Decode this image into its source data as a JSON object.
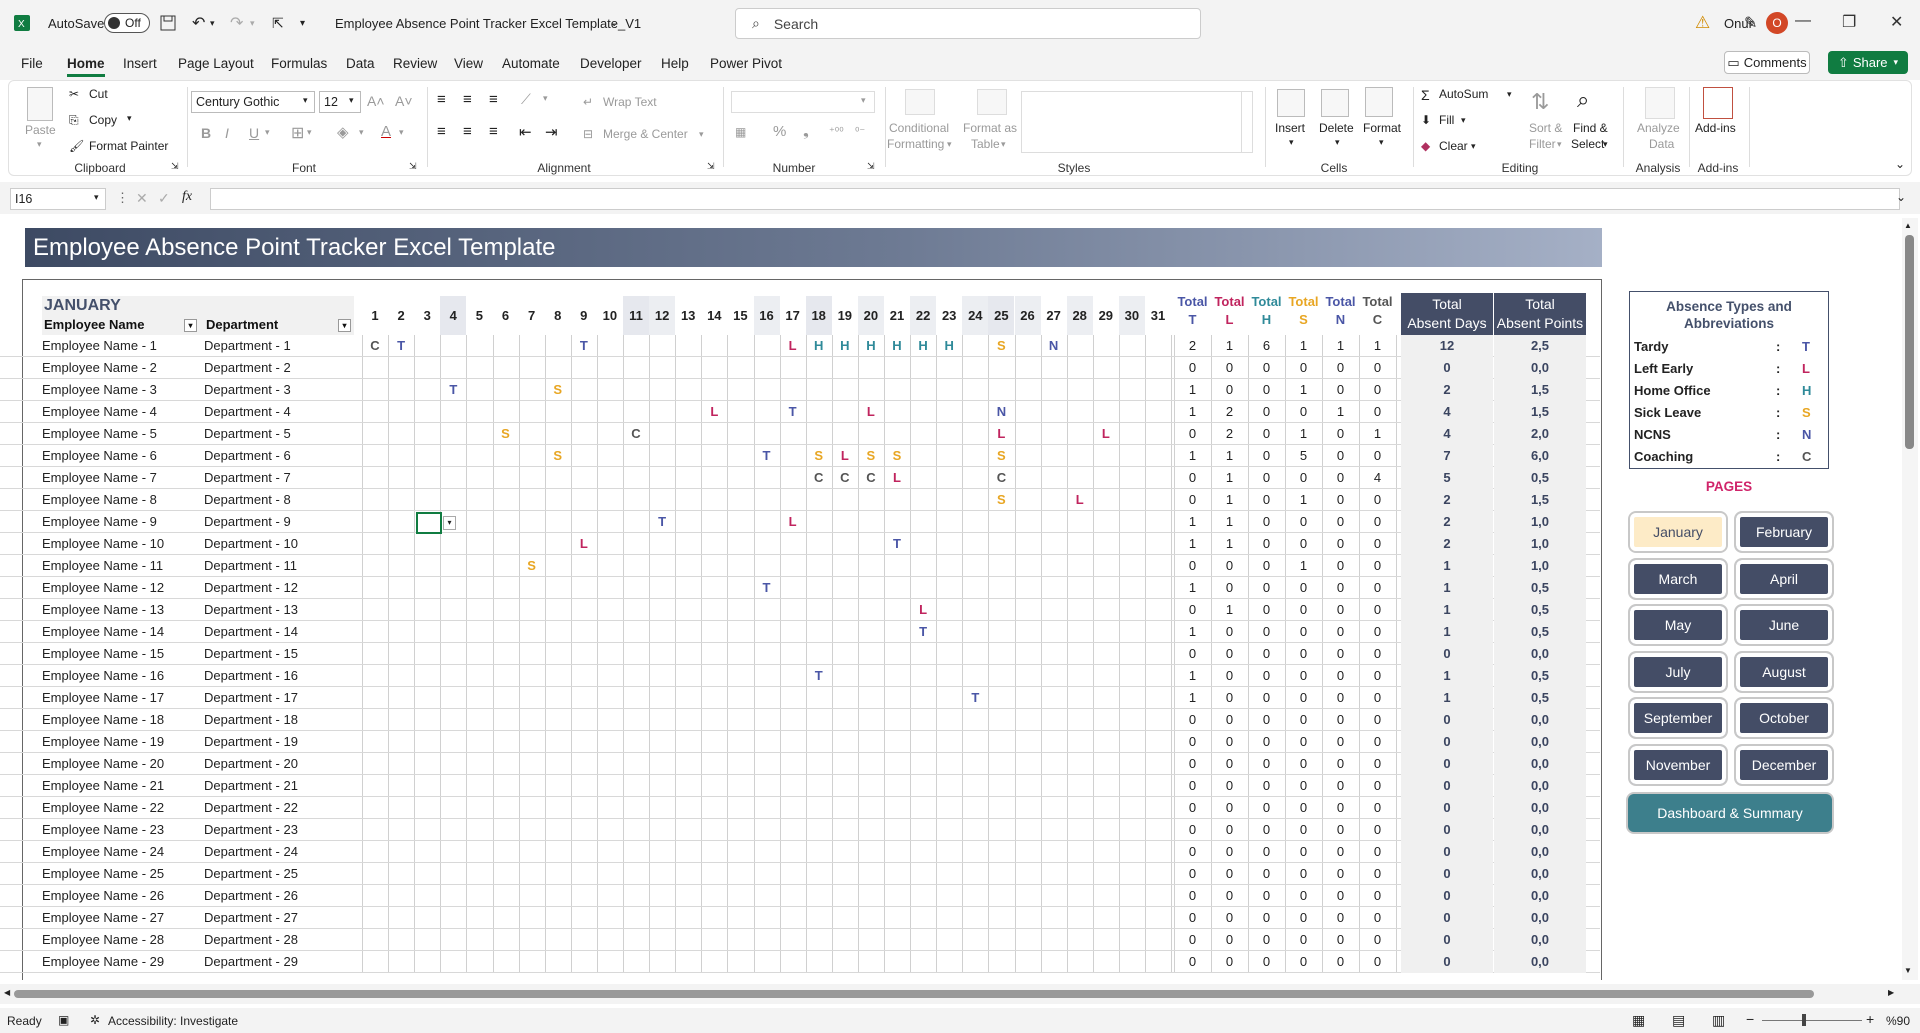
{
  "titlebar": {
    "autosave_label": "AutoSave",
    "autosave_state": "Off",
    "file_title": "Employee Absence Point Tracker Excel Template_V1",
    "search_placeholder": "Search",
    "user_name": "Onur",
    "user_initial": "O"
  },
  "menu": {
    "items": [
      "File",
      "Home",
      "Insert",
      "Page Layout",
      "Formulas",
      "Data",
      "Review",
      "View",
      "Automate",
      "Developer",
      "Help",
      "Power Pivot"
    ],
    "active": "Home",
    "comments_label": "Comments",
    "share_label": "Share"
  },
  "ribbon": {
    "paste": "Paste",
    "cut": "Cut",
    "copy": "Copy",
    "format_painter": "Format Painter",
    "group_clipboard": "Clipboard",
    "font_name": "Century Gothic",
    "font_size": "12",
    "group_font": "Font",
    "wrap_text": "Wrap Text",
    "merge_center": "Merge & Center",
    "group_alignment": "Alignment",
    "group_number": "Number",
    "conditional_formatting": "Conditional",
    "conditional_formatting2": "Formatting",
    "format_as_table": "Format as",
    "format_as_table2": "Table",
    "group_styles": "Styles",
    "insert": "Insert",
    "delete": "Delete",
    "format": "Format",
    "group_cells": "Cells",
    "autosum": "AutoSum",
    "fill": "Fill",
    "clear": "Clear",
    "sort_filter": "Sort &",
    "sort_filter2": "Filter",
    "find_select": "Find &",
    "find_select2": "Select",
    "group_editing": "Editing",
    "analyze_data": "Analyze",
    "analyze_data2": "Data",
    "group_analysis": "Analysis",
    "addins": "Add-ins",
    "group_addins": "Add-ins"
  },
  "formula_bar": {
    "name_box": "I16",
    "fx": "fx",
    "value": ""
  },
  "sheet": {
    "banner_title": "Employee Absence Point Tracker Excel Template",
    "month": "JANUARY",
    "col_employee": "Employee Name",
    "col_department": "Department",
    "days": [
      "1",
      "2",
      "3",
      "4",
      "5",
      "6",
      "7",
      "8",
      "9",
      "10",
      "11",
      "12",
      "13",
      "14",
      "15",
      "16",
      "17",
      "18",
      "19",
      "20",
      "21",
      "22",
      "23",
      "24",
      "25",
      "26",
      "27",
      "28",
      "29",
      "30",
      "31"
    ],
    "total_word": "Total",
    "totals_keys": [
      "T",
      "L",
      "H",
      "S",
      "N",
      "C"
    ],
    "total_absent_days": [
      "Total",
      "Absent Days"
    ],
    "total_absent_points": [
      "Total",
      "Absent Points"
    ],
    "rows": [
      {
        "name": "Employee Name - 1",
        "dept": "Department - 1",
        "marks": {
          "1": "C",
          "2": "T",
          "9": "T",
          "17": "L",
          "18": "H",
          "19": "H",
          "20": "H",
          "21": "H",
          "22": "H",
          "23": "H",
          "25": "S",
          "27": "N"
        },
        "totals": [
          "2",
          "1",
          "6",
          "1",
          "1",
          "1"
        ],
        "days": "12",
        "points": "2,5"
      },
      {
        "name": "Employee Name - 2",
        "dept": "Department - 2",
        "marks": {},
        "totals": [
          "0",
          "0",
          "0",
          "0",
          "0",
          "0"
        ],
        "days": "0",
        "points": "0,0"
      },
      {
        "name": "Employee Name - 3",
        "dept": "Department - 3",
        "marks": {
          "4": "T",
          "8": "S"
        },
        "totals": [
          "1",
          "0",
          "0",
          "1",
          "0",
          "0"
        ],
        "days": "2",
        "points": "1,5"
      },
      {
        "name": "Employee Name - 4",
        "dept": "Department - 4",
        "marks": {
          "14": "L",
          "17": "T",
          "20": "L",
          "25": "N"
        },
        "totals": [
          "1",
          "2",
          "0",
          "0",
          "1",
          "0"
        ],
        "days": "4",
        "points": "1,5"
      },
      {
        "name": "Employee Name - 5",
        "dept": "Department - 5",
        "marks": {
          "6": "S",
          "11": "C",
          "25": "L",
          "29": "L"
        },
        "totals": [
          "0",
          "2",
          "0",
          "1",
          "0",
          "1"
        ],
        "days": "4",
        "points": "2,0"
      },
      {
        "name": "Employee Name - 6",
        "dept": "Department - 6",
        "marks": {
          "8": "S",
          "16": "T",
          "18": "S",
          "19": "L",
          "20": "S",
          "21": "S",
          "25": "S"
        },
        "totals": [
          "1",
          "1",
          "0",
          "5",
          "0",
          "0"
        ],
        "days": "7",
        "points": "6,0"
      },
      {
        "name": "Employee Name - 7",
        "dept": "Department - 7",
        "marks": {
          "18": "C",
          "19": "C",
          "20": "C",
          "21": "L",
          "25": "C"
        },
        "totals": [
          "0",
          "1",
          "0",
          "0",
          "0",
          "4"
        ],
        "days": "5",
        "points": "0,5"
      },
      {
        "name": "Employee Name - 8",
        "dept": "Department - 8",
        "marks": {
          "25": "S",
          "28": "L"
        },
        "totals": [
          "0",
          "1",
          "0",
          "1",
          "0",
          "0"
        ],
        "days": "2",
        "points": "1,5"
      },
      {
        "name": "Employee Name - 9",
        "dept": "Department - 9",
        "marks": {
          "12": "T",
          "17": "L"
        },
        "totals": [
          "1",
          "1",
          "0",
          "0",
          "0",
          "0"
        ],
        "days": "2",
        "points": "1,0"
      },
      {
        "name": "Employee Name - 10",
        "dept": "Department - 10",
        "marks": {
          "9": "L",
          "21": "T"
        },
        "totals": [
          "1",
          "1",
          "0",
          "0",
          "0",
          "0"
        ],
        "days": "2",
        "points": "1,0"
      },
      {
        "name": "Employee Name - 11",
        "dept": "Department - 11",
        "marks": {
          "7": "S"
        },
        "totals": [
          "0",
          "0",
          "0",
          "1",
          "0",
          "0"
        ],
        "days": "1",
        "points": "1,0"
      },
      {
        "name": "Employee Name - 12",
        "dept": "Department - 12",
        "marks": {
          "16": "T"
        },
        "totals": [
          "1",
          "0",
          "0",
          "0",
          "0",
          "0"
        ],
        "days": "1",
        "points": "0,5"
      },
      {
        "name": "Employee Name - 13",
        "dept": "Department - 13",
        "marks": {
          "22": "L"
        },
        "totals": [
          "0",
          "1",
          "0",
          "0",
          "0",
          "0"
        ],
        "days": "1",
        "points": "0,5"
      },
      {
        "name": "Employee Name - 14",
        "dept": "Department - 14",
        "marks": {
          "22": "T"
        },
        "totals": [
          "1",
          "0",
          "0",
          "0",
          "0",
          "0"
        ],
        "days": "1",
        "points": "0,5"
      },
      {
        "name": "Employee Name - 15",
        "dept": "Department - 15",
        "marks": {},
        "totals": [
          "0",
          "0",
          "0",
          "0",
          "0",
          "0"
        ],
        "days": "0",
        "points": "0,0"
      },
      {
        "name": "Employee Name - 16",
        "dept": "Department - 16",
        "marks": {
          "18": "T"
        },
        "totals": [
          "1",
          "0",
          "0",
          "0",
          "0",
          "0"
        ],
        "days": "1",
        "points": "0,5"
      },
      {
        "name": "Employee Name - 17",
        "dept": "Department - 17",
        "marks": {
          "24": "T"
        },
        "totals": [
          "1",
          "0",
          "0",
          "0",
          "0",
          "0"
        ],
        "days": "1",
        "points": "0,5"
      },
      {
        "name": "Employee Name - 18",
        "dept": "Department - 18",
        "marks": {},
        "totals": [
          "0",
          "0",
          "0",
          "0",
          "0",
          "0"
        ],
        "days": "0",
        "points": "0,0"
      },
      {
        "name": "Employee Name - 19",
        "dept": "Department - 19",
        "marks": {},
        "totals": [
          "0",
          "0",
          "0",
          "0",
          "0",
          "0"
        ],
        "days": "0",
        "points": "0,0"
      },
      {
        "name": "Employee Name - 20",
        "dept": "Department - 20",
        "marks": {},
        "totals": [
          "0",
          "0",
          "0",
          "0",
          "0",
          "0"
        ],
        "days": "0",
        "points": "0,0"
      },
      {
        "name": "Employee Name - 21",
        "dept": "Department - 21",
        "marks": {},
        "totals": [
          "0",
          "0",
          "0",
          "0",
          "0",
          "0"
        ],
        "days": "0",
        "points": "0,0"
      },
      {
        "name": "Employee Name - 22",
        "dept": "Department - 22",
        "marks": {},
        "totals": [
          "0",
          "0",
          "0",
          "0",
          "0",
          "0"
        ],
        "days": "0",
        "points": "0,0"
      },
      {
        "name": "Employee Name - 23",
        "dept": "Department - 23",
        "marks": {},
        "totals": [
          "0",
          "0",
          "0",
          "0",
          "0",
          "0"
        ],
        "days": "0",
        "points": "0,0"
      },
      {
        "name": "Employee Name - 24",
        "dept": "Department - 24",
        "marks": {},
        "totals": [
          "0",
          "0",
          "0",
          "0",
          "0",
          "0"
        ],
        "days": "0",
        "points": "0,0"
      },
      {
        "name": "Employee Name - 25",
        "dept": "Department - 25",
        "marks": {},
        "totals": [
          "0",
          "0",
          "0",
          "0",
          "0",
          "0"
        ],
        "days": "0",
        "points": "0,0"
      },
      {
        "name": "Employee Name - 26",
        "dept": "Department - 26",
        "marks": {},
        "totals": [
          "0",
          "0",
          "0",
          "0",
          "0",
          "0"
        ],
        "days": "0",
        "points": "0,0"
      },
      {
        "name": "Employee Name - 27",
        "dept": "Department - 27",
        "marks": {},
        "totals": [
          "0",
          "0",
          "0",
          "0",
          "0",
          "0"
        ],
        "days": "0",
        "points": "0,0"
      },
      {
        "name": "Employee Name - 28",
        "dept": "Department - 28",
        "marks": {},
        "totals": [
          "0",
          "0",
          "0",
          "0",
          "0",
          "0"
        ],
        "days": "0",
        "points": "0,0"
      },
      {
        "name": "Employee Name - 29",
        "dept": "Department - 29",
        "marks": {},
        "totals": [
          "0",
          "0",
          "0",
          "0",
          "0",
          "0"
        ],
        "days": "0",
        "points": "0,0"
      }
    ]
  },
  "legend": {
    "title": "Absence Types and Abbreviations",
    "items": [
      {
        "label": "Tardy",
        "abbr": "T"
      },
      {
        "label": "Left Early",
        "abbr": "L"
      },
      {
        "label": "Home Office",
        "abbr": "H"
      },
      {
        "label": "Sick Leave",
        "abbr": "S"
      },
      {
        "label": "NCNS",
        "abbr": "N"
      },
      {
        "label": "Coaching",
        "abbr": "C"
      }
    ]
  },
  "pages": {
    "title": "PAGES",
    "months": [
      "January",
      "February",
      "March",
      "April",
      "May",
      "June",
      "July",
      "August",
      "September",
      "October",
      "November",
      "December"
    ],
    "active": "January",
    "dashboard": "Dashboard & Summary"
  },
  "status": {
    "ready": "Ready",
    "accessibility": "Accessibility: Investigate",
    "zoom": "%90"
  },
  "colors": {
    "T": "#4a56a6",
    "L": "#c0245e",
    "H": "#2f8a99",
    "S": "#e8a623",
    "N": "#4a56a6",
    "C": "#555555",
    "excel_green": "#107c41",
    "banner_dark": "#3d4a63",
    "header_dark": "#444d66",
    "dashboard": "#3d7f8c",
    "pages_title": "#d0246a"
  },
  "icons": [
    "excel-icon",
    "save-icon",
    "undo-icon",
    "redo-icon",
    "search-icon",
    "warning-icon",
    "pen-icon",
    "minimize-icon",
    "restore-icon",
    "close-icon"
  ]
}
